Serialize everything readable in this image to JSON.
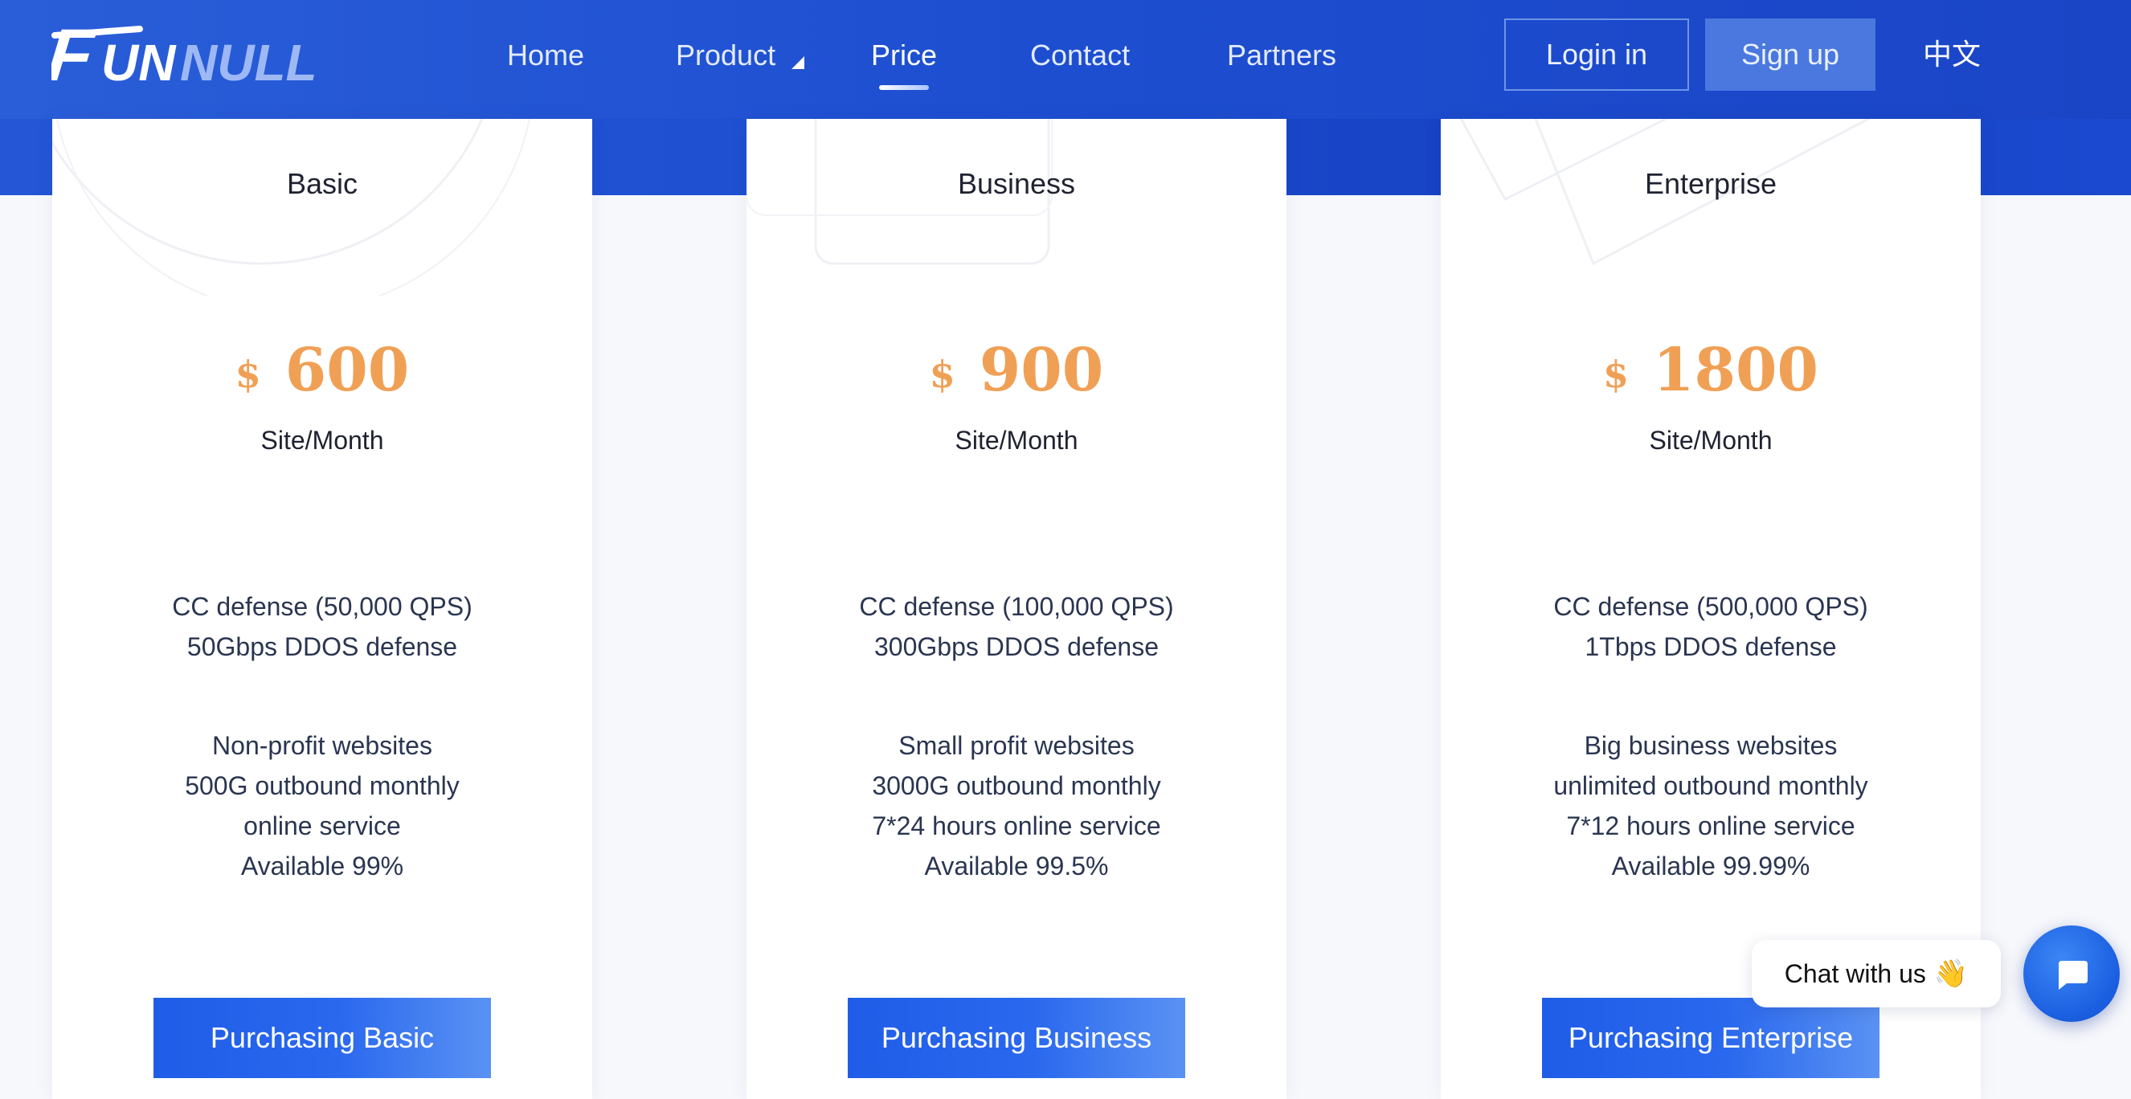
{
  "header": {
    "logo_text": "FUNNULL",
    "nav": [
      {
        "label": "Home"
      },
      {
        "label": "Product"
      },
      {
        "label": "Price"
      },
      {
        "label": "Contact"
      },
      {
        "label": "Partners"
      }
    ],
    "active_nav": "Price",
    "login_label": "Login in",
    "signup_label": "Sign up",
    "language_label": "中文"
  },
  "plans": [
    {
      "name": "Basic",
      "currency": "$",
      "price": "600",
      "unit": "Site/Month",
      "features": [
        "CC defense (50,000 QPS)",
        "50Gbps DDOS defense"
      ],
      "details": [
        "Non-profit websites",
        "500G outbound monthly",
        "online service",
        "Available 99%"
      ],
      "button_label": "Purchasing Basic"
    },
    {
      "name": "Business",
      "currency": "$",
      "price": "900",
      "unit": "Site/Month",
      "features": [
        "CC defense (100,000 QPS)",
        "300Gbps DDOS defense"
      ],
      "details": [
        "Small profit websites",
        "3000G outbound monthly",
        "7*24 hours online service",
        "Available 99.5%"
      ],
      "button_label": "Purchasing Business"
    },
    {
      "name": "Enterprise",
      "currency": "$",
      "price": "1800",
      "unit": "Site/Month",
      "features": [
        "CC defense (500,000 QPS)",
        "1Tbps DDOS defense"
      ],
      "details": [
        "Big business websites",
        "unlimited outbound monthly",
        "7*12 hours online service",
        "Available 99.99%"
      ],
      "button_label": "Purchasing Enterprise"
    }
  ],
  "chat": {
    "label": "Chat with us",
    "emoji": "👋",
    "icon": "chat-bubble-icon"
  },
  "colors": {
    "header_blue": "#1e4fd1",
    "price_orange": "#f0a055",
    "button_blue": "#1f5de8"
  }
}
